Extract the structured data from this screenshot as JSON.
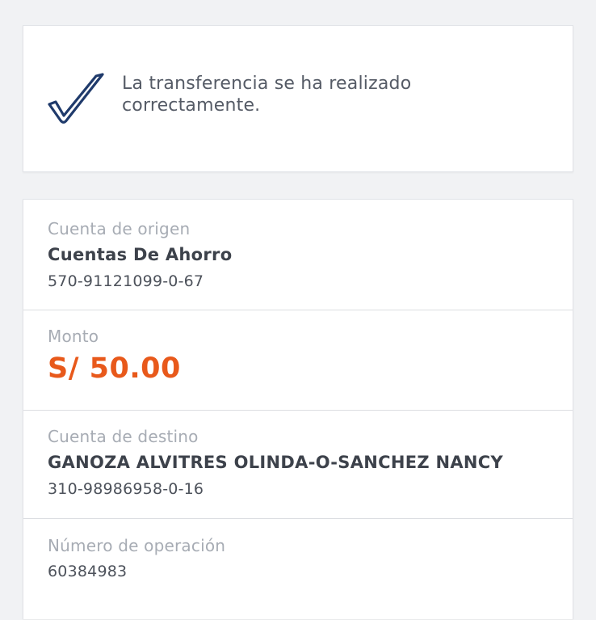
{
  "success": {
    "icon": "checkmark-icon",
    "message": "La transferencia se ha realizado correctamente."
  },
  "origin": {
    "label": "Cuenta de origen",
    "account_type": "Cuentas De Ahorro",
    "account_number": "570-91121099-0-67"
  },
  "amount": {
    "label": "Monto",
    "value": "S/ 50.00"
  },
  "destination": {
    "label": "Cuenta de destino",
    "holder": "GANOZA ALVITRES OLINDA-O-SANCHEZ NANCY",
    "account_number": "310-98986958-0-16"
  },
  "operation": {
    "label": "Número de operación",
    "number": "60384983"
  },
  "colors": {
    "accent": "#e8591b",
    "check": "#1f3a6b",
    "background": "#f1f2f4"
  }
}
